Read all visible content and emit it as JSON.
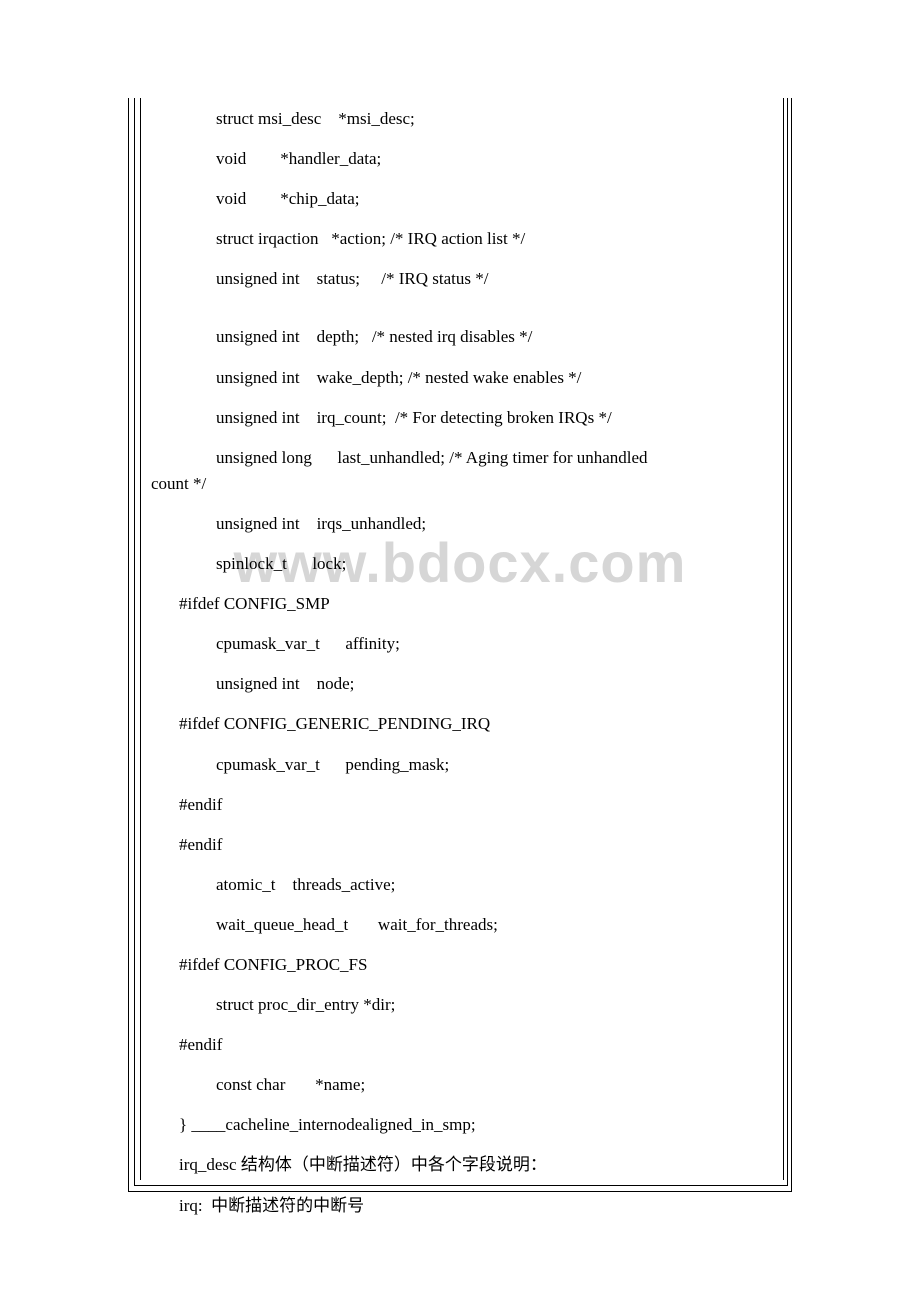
{
  "watermark": "www.bdocx.com",
  "code": {
    "l1": "    struct msi_desc    *msi_desc;",
    "l2": "    void        *handler_data;",
    "l3": "    void        *chip_data;",
    "l4": "    struct irqaction   *action; /* IRQ action list */",
    "l5": "    unsigned int    status;     /* IRQ status */",
    "l6": "    unsigned int    depth;   /* nested irq disables */",
    "l7": "    unsigned int    wake_depth; /* nested wake enables */",
    "l8": "    unsigned int    irq_count;  /* For detecting broken IRQs */",
    "l9a": "    unsigned long      last_unhandled; /* Aging timer for unhandled",
    "l9b": "count */",
    "l10": "    unsigned int    irqs_unhandled;",
    "l11": "    spinlock_t      lock;",
    "l12": "#ifdef CONFIG_SMP",
    "l13": "    cpumask_var_t      affinity;",
    "l14": "    unsigned int    node;",
    "l15": "#ifdef CONFIG_GENERIC_PENDING_IRQ",
    "l16": "    cpumask_var_t      pending_mask;",
    "l17": "#endif",
    "l18": "#endif",
    "l19": "    atomic_t    threads_active;",
    "l20": "    wait_queue_head_t       wait_for_threads;",
    "l21": "#ifdef CONFIG_PROC_FS",
    "l22": "    struct proc_dir_entry *dir;",
    "l23": "#endif",
    "l24": "    const char       *name;",
    "l25": "} ____cacheline_internodealigned_in_smp;",
    "l26": "irq_desc 结构体（中断描述符）中各个字段说明：",
    "l27": "irq:  中断描述符的中断号"
  }
}
